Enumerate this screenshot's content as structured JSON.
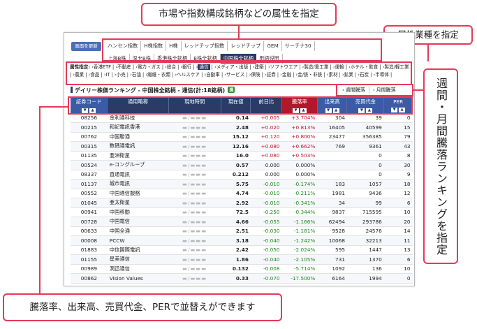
{
  "annotations": {
    "attribute": "市場や指数構成銘柄などの属性を指定",
    "industry": "属性業種を指定",
    "period": "週間・月間騰落ランキングを指定",
    "sort": "騰落率、出来高、売買代金、PERで並替えができます"
  },
  "toolbar": {
    "update_label": "画面を更新"
  },
  "attr_tabs_row1": [
    "ハンセン指数",
    "H株指数",
    "H株",
    "レッドチップ指数",
    "レッドチップ",
    "GEM",
    "サーチナ30"
  ],
  "attr_tabs_row2": [
    "上海B株",
    "深セB株",
    "香港株全銘柄",
    "B株全銘柄",
    "中国株全銘柄",
    "用語説明"
  ],
  "selected_tab": "中国株全銘柄",
  "industry": {
    "label": "属性指定:",
    "items": [
      "香港ETF",
      "不動産",
      "電力・ガス",
      "総合",
      "銀行",
      "通信",
      "メディア・出版",
      "建築",
      "ソフトウエア",
      "製造/重工業",
      "運輸",
      "ホテル・飲食",
      "製造/軽工業",
      "農業",
      "食品",
      "IT",
      "小売",
      "石油",
      "繊維・衣類",
      "ヘルスケア",
      "自動車",
      "サービス",
      "保険",
      "証券",
      "金融",
      "金/鉄・非鉄",
      "素材",
      "鉱業",
      "石炭",
      "半導体"
    ],
    "selected": "通信"
  },
  "ranking": {
    "title": "デイリー株価ランキング - 中国株全銘柄 - 通信(計:18銘柄)",
    "badge": "週",
    "periods": [
      "週間騰落",
      "月間騰落"
    ]
  },
  "columns": [
    "証券コード",
    "通用略称",
    "現地時間",
    "現在値",
    "前日比",
    "騰落率",
    "出来高",
    "売買代金",
    "PER"
  ],
  "time_mask": "▬/▬▬▬",
  "rows": [
    {
      "code": "08256",
      "name": "金利通科技",
      "price": "0.14",
      "chg": "+0.005",
      "rate": "+3.704%",
      "vol": "304",
      "amount": "39",
      "per": "0"
    },
    {
      "code": "00215",
      "name": "和記電訊香港",
      "price": "2.48",
      "chg": "+0.020",
      "rate": "+0.813%",
      "vol": "16405",
      "amount": "40599",
      "per": "15"
    },
    {
      "code": "00762",
      "name": "中国聯通",
      "price": "15.12",
      "chg": "+0.120",
      "rate": "+0.800%",
      "vol": "23477",
      "amount": "356385",
      "per": "79"
    },
    {
      "code": "00315",
      "name": "数碼通電訊",
      "price": "12.16",
      "chg": "+0.080",
      "rate": "+0.662%",
      "vol": "769",
      "amount": "9361",
      "per": "43"
    },
    {
      "code": "01135",
      "name": "亜洲衛星",
      "price": "16.0",
      "chg": "+0.080",
      "rate": "+0.503%",
      "vol": "",
      "amount": "0",
      "per": "8"
    },
    {
      "code": "00524",
      "name": "e-コングループ",
      "price": "0.57",
      "chg": "0.000",
      "rate": "0.000%",
      "vol": "",
      "amount": "0",
      "per": "30"
    },
    {
      "code": "08337",
      "name": "直通電訊",
      "price": "0.212",
      "chg": "0.000",
      "rate": "0.000%",
      "vol": "",
      "amount": "0",
      "per": "9"
    },
    {
      "code": "01137",
      "name": "城市電訊",
      "price": "5.75",
      "chg": "-0.010",
      "rate": "-0.174%",
      "vol": "183",
      "amount": "1057",
      "per": "18"
    },
    {
      "code": "00552",
      "name": "中国通信服務",
      "price": "4.74",
      "chg": "-0.010",
      "rate": "-0.211%",
      "vol": "1981",
      "amount": "9436",
      "per": "12"
    },
    {
      "code": "01045",
      "name": "亜太衛星",
      "price": "2.92",
      "chg": "-0.010",
      "rate": "-0.341%",
      "vol": "34",
      "amount": "99",
      "per": "6"
    },
    {
      "code": "00941",
      "name": "中国移動",
      "price": "72.5",
      "chg": "-0.250",
      "rate": "-0.344%",
      "vol": "9837",
      "amount": "715595",
      "per": "10"
    },
    {
      "code": "00728",
      "name": "中国電信",
      "price": "4.66",
      "chg": "-0.055",
      "rate": "-1.166%",
      "vol": "62494",
      "amount": "293786",
      "per": "20"
    },
    {
      "code": "00633",
      "name": "中国全通",
      "price": "2.51",
      "chg": "-0.030",
      "rate": "-1.181%",
      "vol": "9528",
      "amount": "24576",
      "per": "14"
    },
    {
      "code": "00008",
      "name": "PCCW",
      "price": "3.18",
      "chg": "-0.040",
      "rate": "-1.242%",
      "vol": "10068",
      "amount": "32213",
      "per": "11"
    },
    {
      "code": "01883",
      "name": "中信国際電訊",
      "price": "2.42",
      "chg": "-0.050",
      "rate": "-2.024%",
      "vol": "595",
      "amount": "1447",
      "per": "13"
    },
    {
      "code": "01155",
      "name": "星美通信",
      "price": "1.86",
      "chg": "-0.040",
      "rate": "-2.105%",
      "vol": "731",
      "amount": "1370",
      "per": "6"
    },
    {
      "code": "00989",
      "name": "潤迅通信",
      "price": "0.132",
      "chg": "-0.008",
      "rate": "-5.714%",
      "vol": "1092",
      "amount": "136",
      "per": "10"
    },
    {
      "code": "00862",
      "name": "Vision Values",
      "price": "0.33",
      "chg": "-0.070",
      "rate": "-17.500%",
      "vol": "6164",
      "amount": "1994",
      "per": "0"
    }
  ]
}
